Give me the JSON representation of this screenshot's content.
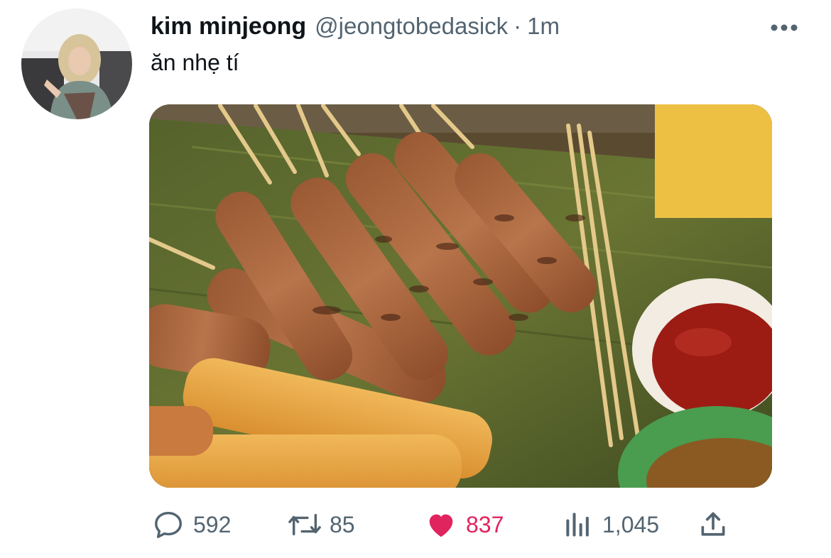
{
  "tweet": {
    "display_name": "kim minjeong",
    "handle": "@jeongtobedasick",
    "separator": "·",
    "time": "1m",
    "text": "ăn nhẹ tí",
    "more_icon": "more-horizontal-icon",
    "media_alt": "grilled meat skewers with fried fish sticks and dipping sauces on a banana leaf"
  },
  "actions": {
    "replies": "592",
    "retweets": "85",
    "likes": "837",
    "views": "1,045"
  },
  "colors": {
    "text_primary": "#0f1419",
    "text_secondary": "#536471",
    "like_accent": "#e0245e"
  }
}
